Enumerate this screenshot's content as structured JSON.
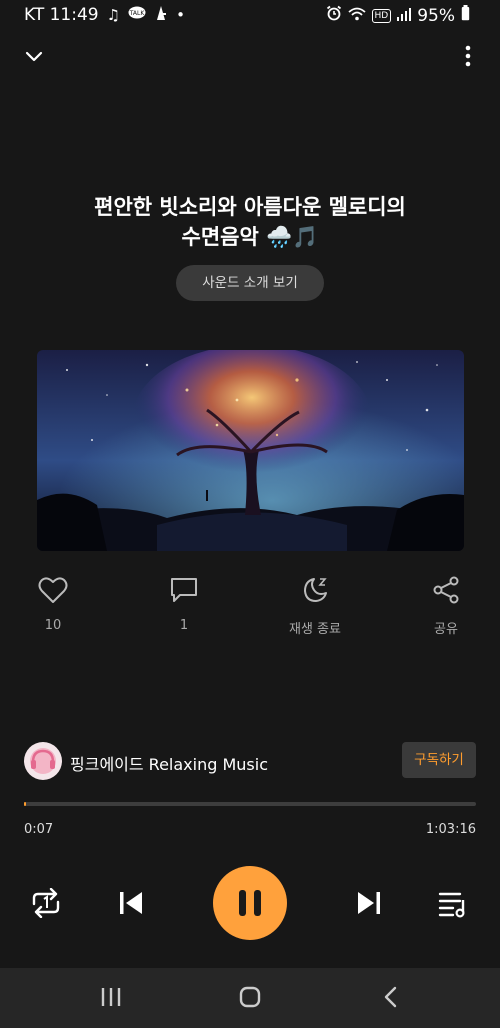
{
  "status_bar": {
    "carrier_time": "KT 11:49",
    "battery": "95%",
    "hd_label": "HD"
  },
  "track": {
    "title_line1": "편안한 빗소리와 아름다운 멜로디의",
    "title_line2": "수면음악 🌧️🎵"
  },
  "sound_intro_label": "사운드 소개 보기",
  "actions": {
    "like_count": "10",
    "comment_count": "1",
    "sleep_timer_label": "재생 종료",
    "share_label": "공유"
  },
  "channel": {
    "name": "핑크에이드 Relaxing Music",
    "subscribe_label": "구독하기"
  },
  "playback": {
    "elapsed": "0:07",
    "duration": "1:03:16",
    "progress": 0.0018
  },
  "icons": [
    "chevron-down-icon",
    "more-vert-icon",
    "heart-icon",
    "comment-icon",
    "moon-sleep-icon",
    "share-icon",
    "repeat-icon",
    "previous-icon",
    "pause-icon",
    "next-icon",
    "playlist-icon",
    "recent-apps-icon",
    "home-icon",
    "back-icon"
  ],
  "colors": {
    "accent": "#ff9d2e",
    "background": "#171717"
  }
}
